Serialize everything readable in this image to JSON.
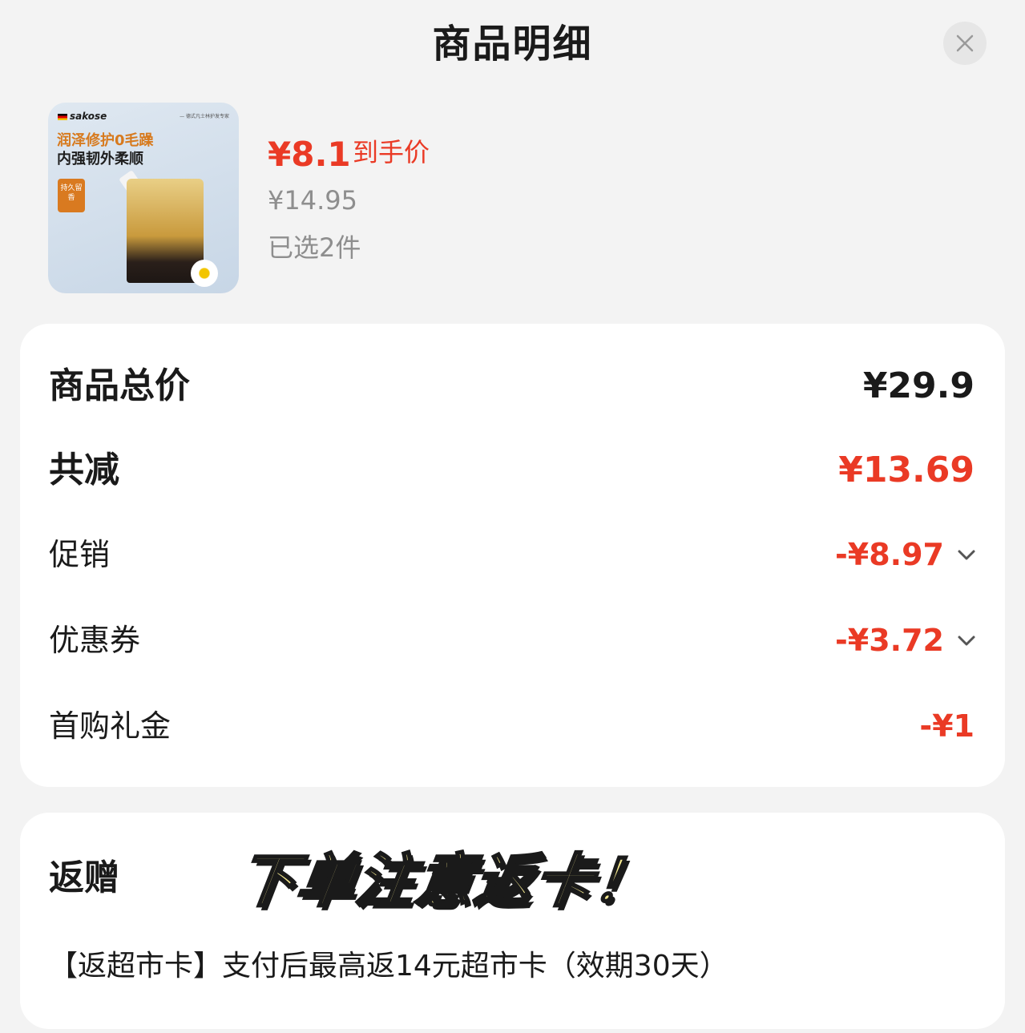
{
  "header": {
    "title": "商品明细",
    "close_icon": "close-icon"
  },
  "product": {
    "image": {
      "brand": "sakose",
      "top_tag": "— 德式凡士林护发专家",
      "slogan_line1": "润泽修护0毛躁",
      "slogan_line2": "内强韧外柔顺",
      "badge": "持久留香"
    },
    "final_price": "¥8.1",
    "final_price_label": "到手价",
    "original_price": "¥14.95",
    "selected_count": "已选2件"
  },
  "summary": {
    "total_label": "商品总价",
    "total_value": "¥29.9",
    "discount_label": "共减",
    "discount_value": "¥13.69",
    "rows": [
      {
        "label": "促销",
        "value": "-¥8.97",
        "expandable": true
      },
      {
        "label": "优惠券",
        "value": "-¥3.72",
        "expandable": true
      },
      {
        "label": "首购礼金",
        "value": "-¥1",
        "expandable": false
      }
    ]
  },
  "rebate": {
    "title": "返赠",
    "banner": "下单注意返卡！",
    "description": "【返超市卡】支付后最高返14元超市卡（效期30天）"
  },
  "colors": {
    "accent_red": "#ea3a25",
    "background": "#f3f3f3",
    "card": "#ffffff",
    "muted_text": "#8e8e8e",
    "banner_fill": "#f4e88f"
  }
}
